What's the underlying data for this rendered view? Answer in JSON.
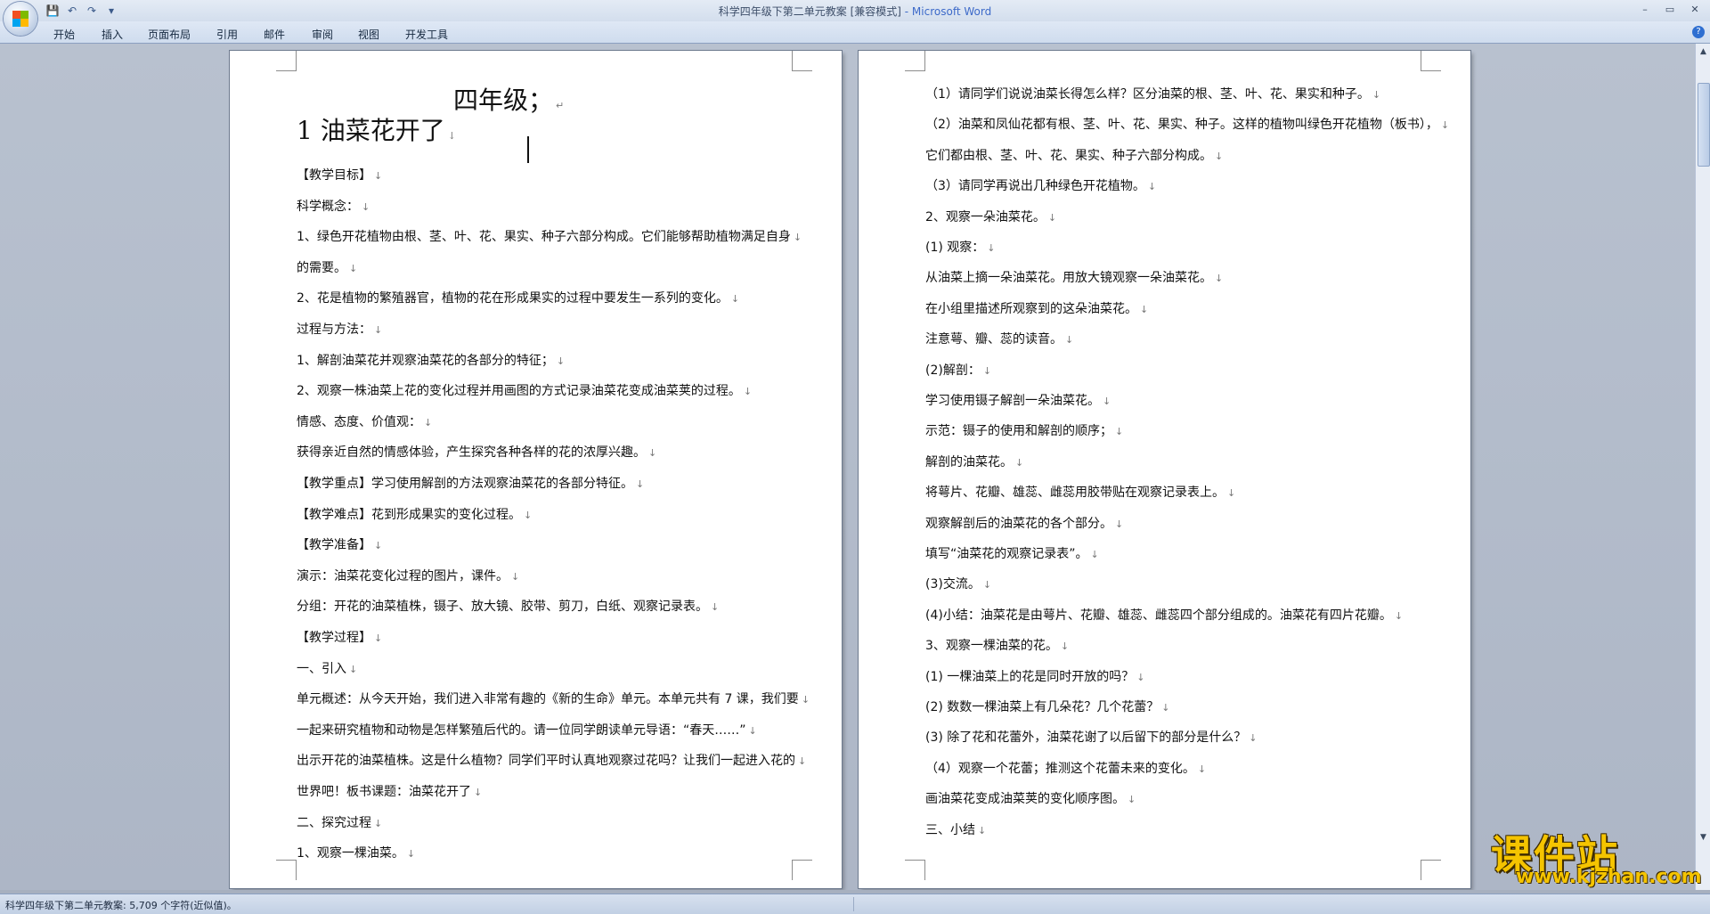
{
  "window": {
    "title": "科学四年级下第二单元教案 [兼容模式]",
    "app_name": " - Microsoft Word",
    "controls": [
      "–",
      "▭",
      "✕"
    ],
    "qat": [
      "💾",
      "↶",
      "↷",
      "▾"
    ]
  },
  "ribbon_tabs": [
    "开始",
    "插入",
    "页面布局",
    "引用",
    "邮件",
    "审阅",
    "视图",
    "开发工具"
  ],
  "help_icon": "?",
  "left_page": {
    "grade_heading": "四年级；",
    "lesson_title": "1 油菜花开了",
    "lines": [
      "【教学目标】",
      "科学概念：",
      "1、绿色开花植物由根、茎、叶、花、果实、种子六部分构成。它们能够帮助植物满足自身",
      "的需要。",
      "2、花是植物的繁殖器官，植物的花在形成果实的过程中要发生一系列的变化。",
      "过程与方法：",
      "1、解剖油菜花并观察油菜花的各部分的特征；",
      "2、观察一株油菜上花的变化过程并用画图的方式记录油菜花变成油菜荚的过程。",
      "情感、态度、价值观：",
      "获得亲近自然的情感体验，产生探究各种各样的花的浓厚兴趣。",
      "【教学重点】学习使用解剖的方法观察油菜花的各部分特征。",
      "【教学难点】花到形成果实的变化过程。",
      "【教学准备】",
      "演示：油菜花变化过程的图片，课件。",
      "分组：开花的油菜植株，镊子、放大镜、胶带、剪刀，白纸、观察记录表。",
      "【教学过程】",
      "一、引入",
      "单元概述：从今天开始，我们进入非常有趣的《新的生命》单元。本单元共有 7 课，我们要",
      "一起来研究植物和动物是怎样繁殖后代的。请一位同学朗读单元导语：“春天……”",
      "出示开花的油菜植株。这是什么植物？同学们平时认真地观察过花吗？让我们一起进入花的",
      "世界吧！板书课题：油菜花开了",
      "二、探究过程",
      "1、观察一棵油菜。"
    ]
  },
  "right_page": {
    "lines": [
      "（1）请同学们说说油菜长得怎么样？区分油菜的根、茎、叶、花、果实和种子。",
      "（2）油菜和凤仙花都有根、茎、叶、花、果实、种子。这样的植物叫绿色开花植物（板书），",
      "它们都由根、茎、叶、花、果实、种子六部分构成。",
      "（3）请同学再说出几种绿色开花植物。",
      "2、观察一朵油菜花。",
      "(1) 观察：",
      "从油菜上摘一朵油菜花。用放大镜观察一朵油菜花。",
      "在小组里描述所观察到的这朵油菜花。",
      "注意萼、瓣、蕊的读音。",
      "(2)解剖：",
      "学习使用镊子解剖一朵油菜花。",
      "示范：镊子的使用和解剖的顺序；",
      "解剖的油菜花。",
      "将萼片、花瓣、雄蕊、雌蕊用胶带贴在观察记录表上。",
      "观察解剖后的油菜花的各个部分。",
      "填写“油菜花的观察记录表”。",
      "(3)交流。",
      "(4)小结：油菜花是由萼片、花瓣、雄蕊、雌蕊四个部分组成的。油菜花有四片花瓣。",
      "3、观察一棵油菜的花。",
      "(1) 一棵油菜上的花是同时开放的吗？",
      "(2) 数数一棵油菜上有几朵花？几个花蕾？",
      "(3) 除了花和花蕾外，油菜花谢了以后留下的部分是什么？",
      "（4）观察一个花蕾；推测这个花蕾未来的变化。",
      "画油菜花变成油菜荚的变化顺序图。",
      "三、小结"
    ]
  },
  "paragraph_mark": "↓",
  "heading_mark": "↵",
  "status_bar": {
    "text": "科学四年级下第二单元教案: 5,709 个字符(近似值)。"
  },
  "scrollbar": {
    "up": "▲",
    "down": "▼"
  },
  "watermark": {
    "text": "课件站",
    "url": "www.kjzhan.com"
  }
}
